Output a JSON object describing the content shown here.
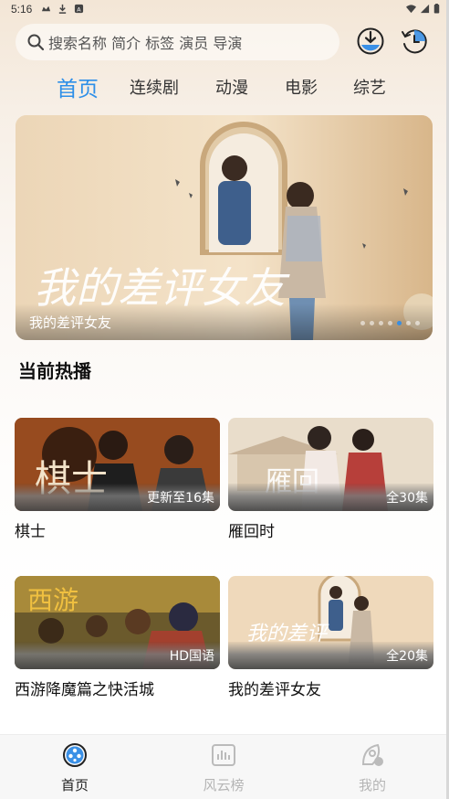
{
  "status_bar": {
    "time": "5:16"
  },
  "search": {
    "placeholder": "搜索名称 简介 标签 演员 导演"
  },
  "top_actions": {
    "download_icon": "download-icon",
    "history_icon": "history-icon"
  },
  "tabs": [
    {
      "label": "首页",
      "active": true
    },
    {
      "label": "连续剧",
      "active": false
    },
    {
      "label": "动漫",
      "active": false
    },
    {
      "label": "电影",
      "active": false
    },
    {
      "label": "综艺",
      "active": false
    }
  ],
  "banner": {
    "caption": "我的差评女友",
    "slide_count": 7,
    "active_slide": 5
  },
  "section": {
    "title": "当前热播"
  },
  "cards": [
    {
      "title": "棋士",
      "badge": "更新至16集"
    },
    {
      "title": "雁回时",
      "badge": "全30集"
    },
    {
      "title": "西游降魔篇之快活城",
      "badge": "HD国语"
    },
    {
      "title": "我的差评女友",
      "badge": "全20集"
    }
  ],
  "bottom_nav": [
    {
      "label": "首页",
      "icon": "home-film-icon",
      "active": true
    },
    {
      "label": "风云榜",
      "icon": "chart-icon",
      "active": false
    },
    {
      "label": "我的",
      "icon": "profile-icon",
      "active": false
    }
  ],
  "colors": {
    "accent": "#2d8fe8",
    "inactive": "#b5b5b5"
  }
}
